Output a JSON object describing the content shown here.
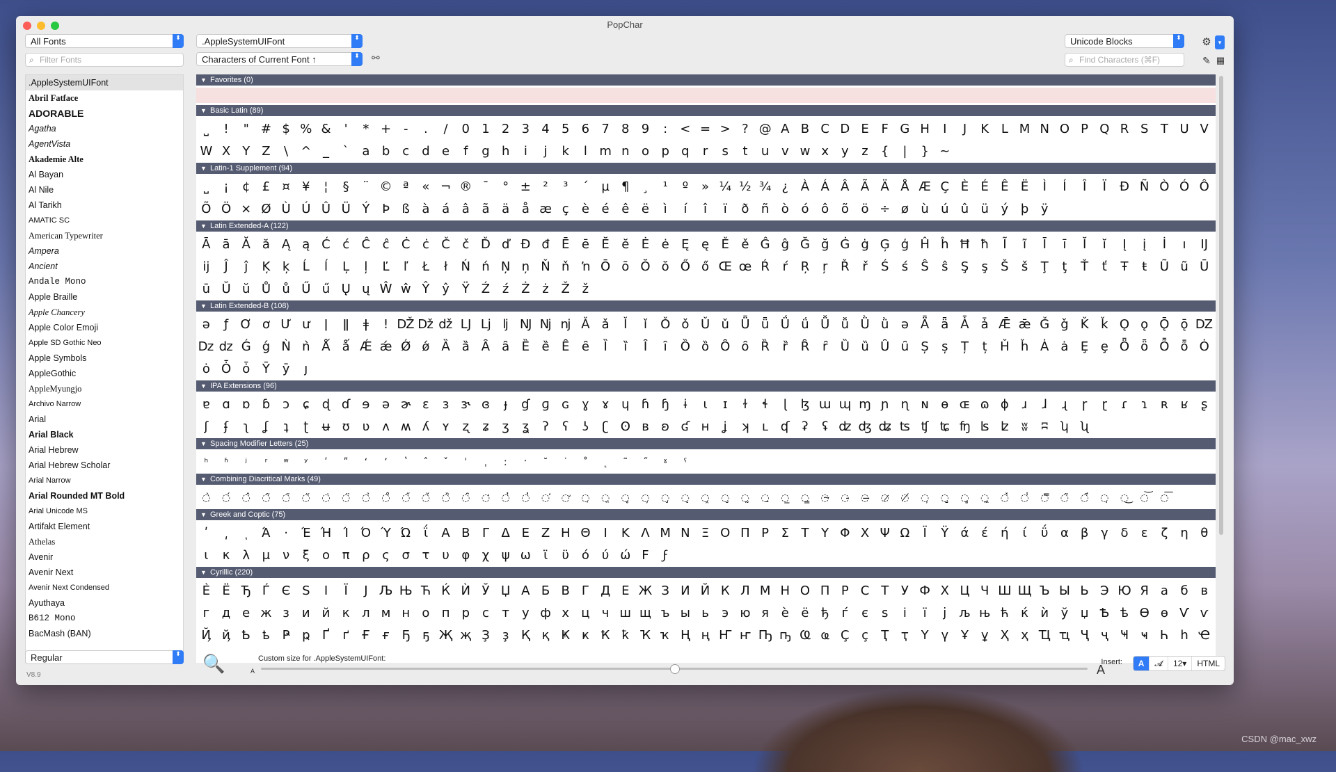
{
  "window": {
    "title": "PopChar"
  },
  "toolbar": {
    "font_filter_select": "All Fonts",
    "filter_fonts_placeholder": "Filter Fonts",
    "current_font_select": ".AppleSystemUIFont",
    "character_set_select": "Characters of Current Font ↑",
    "view_mode_select": "Unicode Blocks",
    "find_placeholder": "Find Characters (⌘F)"
  },
  "icons": {
    "search": "⌕",
    "link": "⚯",
    "gear": "⚙",
    "chevron": "▾",
    "pencil": "✎",
    "grid": "▦",
    "zoom": "🔍",
    "triangle": "▼",
    "updown": "⬍"
  },
  "font_list": [
    ".AppleSystemUIFont",
    "Abril Fatface",
    "ADORABLE",
    "Agatha",
    "AgentVista",
    "Akademie Alte",
    "Al Bayan",
    "Al Nile",
    "Al Tarikh",
    "AMATIC SC",
    "American Typewriter",
    "Ampera",
    "Ancient",
    "Andale Mono",
    "Apple Braille",
    "Apple Chancery",
    "Apple Color Emoji",
    "Apple SD Gothic Neo",
    "Apple Symbols",
    "AppleGothic",
    "AppleMyungjo",
    "Archivo Narrow",
    "Arial",
    "Arial Black",
    "Arial Hebrew",
    "Arial Hebrew Scholar",
    "Arial Narrow",
    "Arial Rounded MT Bold",
    "Arial Unicode MS",
    "Artifakt Element",
    "Athelas",
    "Avenir",
    "Avenir Next",
    "Avenir Next Condensed",
    "Ayuthaya",
    "B612 Mono",
    "BacMash (BAN)"
  ],
  "style_select": "Regular",
  "version": "V8.9",
  "blocks": [
    {
      "title": "Favorites (0)",
      "rows": []
    },
    {
      "title": "Basic Latin (89)",
      "rows": [
        [
          "⎵",
          "!",
          "\"",
          "#",
          "$",
          "%",
          "&",
          "'",
          "*",
          "+",
          "-",
          ".",
          "/",
          "0",
          "1",
          "2",
          "3",
          "4",
          "5",
          "6",
          "7",
          "8",
          "9",
          ":",
          "<",
          "=",
          ">",
          "?",
          "@",
          "A",
          "B",
          "C",
          "D",
          "E",
          "F",
          "G",
          "H",
          "I",
          "J",
          "K",
          "L",
          "M",
          "N",
          "O",
          "P",
          "Q",
          "R",
          "S",
          "T",
          "U",
          "V"
        ],
        [
          "W",
          "X",
          "Y",
          "Z",
          "\\",
          "^",
          "_",
          "`",
          "a",
          "b",
          "c",
          "d",
          "e",
          "f",
          "g",
          "h",
          "i",
          "j",
          "k",
          "l",
          "m",
          "n",
          "o",
          "p",
          "q",
          "r",
          "s",
          "t",
          "u",
          "v",
          "w",
          "x",
          "y",
          "z",
          "{",
          "|",
          "}",
          "~"
        ]
      ]
    },
    {
      "title": "Latin-1 Supplement (94)",
      "rows": [
        [
          "⎵",
          "¡",
          "¢",
          "£",
          "¤",
          "¥",
          "¦",
          "§",
          "¨",
          "©",
          "ª",
          "«",
          "¬",
          "®",
          "¯",
          "°",
          "±",
          "²",
          "³",
          "´",
          "µ",
          "¶",
          "¸",
          "¹",
          "º",
          "»",
          "¼",
          "½",
          "¾",
          "¿",
          "À",
          "Á",
          "Â",
          "Ã",
          "Ä",
          "Å",
          "Æ",
          "Ç",
          "È",
          "É",
          "Ê",
          "Ë",
          "Ì",
          "Í",
          "Î",
          "Ï",
          "Ð",
          "Ñ",
          "Ò",
          "Ó",
          "Ô"
        ],
        [
          "Õ",
          "Ö",
          "×",
          "Ø",
          "Ù",
          "Ú",
          "Û",
          "Ü",
          "Ý",
          "Þ",
          "ß",
          "à",
          "á",
          "â",
          "ã",
          "ä",
          "å",
          "æ",
          "ç",
          "è",
          "é",
          "ê",
          "ë",
          "ì",
          "í",
          "î",
          "ï",
          "ð",
          "ñ",
          "ò",
          "ó",
          "ô",
          "õ",
          "ö",
          "÷",
          "ø",
          "ù",
          "ú",
          "û",
          "ü",
          "ý",
          "þ",
          "ÿ"
        ]
      ]
    },
    {
      "title": "Latin Extended-A (122)",
      "rows": [
        [
          "Ā",
          "ā",
          "Ă",
          "ă",
          "Ą",
          "ą",
          "Ć",
          "ć",
          "Ĉ",
          "ĉ",
          "Ċ",
          "ċ",
          "Č",
          "č",
          "Ď",
          "ď",
          "Đ",
          "đ",
          "Ē",
          "ē",
          "Ĕ",
          "ĕ",
          "Ė",
          "ė",
          "Ę",
          "ę",
          "Ě",
          "ě",
          "Ĝ",
          "ĝ",
          "Ğ",
          "ğ",
          "Ġ",
          "ġ",
          "Ģ",
          "ģ",
          "Ĥ",
          "ĥ",
          "Ħ",
          "ħ",
          "Ĩ",
          "ĩ",
          "Ī",
          "ī",
          "Ĭ",
          "ĭ",
          "Į",
          "į",
          "İ",
          "ı",
          "Ĳ"
        ],
        [
          "ĳ",
          "Ĵ",
          "ĵ",
          "Ķ",
          "ķ",
          "Ĺ",
          "ĺ",
          "Ļ",
          "ļ",
          "Ľ",
          "ľ",
          "Ł",
          "ł",
          "Ń",
          "ń",
          "Ņ",
          "ņ",
          "Ň",
          "ň",
          "ŉ",
          "Ō",
          "ō",
          "Ŏ",
          "ŏ",
          "Ő",
          "ő",
          "Œ",
          "œ",
          "Ŕ",
          "ŕ",
          "Ŗ",
          "ŗ",
          "Ř",
          "ř",
          "Ś",
          "ś",
          "Ŝ",
          "ŝ",
          "Ş",
          "ş",
          "Š",
          "š",
          "Ţ",
          "ţ",
          "Ť",
          "ť",
          "Ŧ",
          "ŧ",
          "Ũ",
          "ũ",
          "Ū"
        ],
        [
          "ū",
          "Ŭ",
          "ŭ",
          "Ů",
          "ů",
          "Ű",
          "ű",
          "Ų",
          "ų",
          "Ŵ",
          "ŵ",
          "Ŷ",
          "ŷ",
          "Ÿ",
          "Ź",
          "ź",
          "Ż",
          "ż",
          "Ž",
          "ž"
        ]
      ]
    },
    {
      "title": "Latin Extended-B (108)",
      "rows": [
        [
          "ə",
          "ƒ",
          "Ơ",
          "ơ",
          "Ư",
          "ư",
          "ǀ",
          "ǁ",
          "ǂ",
          "ǃ",
          "Ǆ",
          "ǅ",
          "ǆ",
          "Ǉ",
          "ǈ",
          "ǉ",
          "Ǌ",
          "ǋ",
          "ǌ",
          "Ǎ",
          "ǎ",
          "Ǐ",
          "ǐ",
          "Ǒ",
          "ǒ",
          "Ǔ",
          "ǔ",
          "Ǖ",
          "ǖ",
          "Ǘ",
          "ǘ",
          "Ǚ",
          "ǚ",
          "Ǜ",
          "ǜ",
          "ǝ",
          "Ǟ",
          "ǟ",
          "Ǡ",
          "ǡ",
          "Ǣ",
          "ǣ",
          "Ǧ",
          "ǧ",
          "Ǩ",
          "ǩ",
          "Ǫ",
          "ǫ",
          "Ǭ",
          "ǭ",
          "Ǳ"
        ],
        [
          "ǲ",
          "ǳ",
          "Ǵ",
          "ǵ",
          "Ǹ",
          "ǹ",
          "Ǻ",
          "ǻ",
          "Ǽ",
          "ǽ",
          "Ǿ",
          "ǿ",
          "Ȁ",
          "ȁ",
          "Ȃ",
          "ȃ",
          "Ȅ",
          "ȅ",
          "Ȇ",
          "ȇ",
          "Ȉ",
          "ȉ",
          "Ȋ",
          "ȋ",
          "Ȍ",
          "ȍ",
          "Ȏ",
          "ȏ",
          "Ȑ",
          "ȑ",
          "Ȓ",
          "ȓ",
          "Ȕ",
          "ȕ",
          "Ȗ",
          "ȗ",
          "Ș",
          "ș",
          "Ț",
          "ț",
          "Ȟ",
          "ȟ",
          "Ȧ",
          "ȧ",
          "Ȩ",
          "ȩ",
          "Ȫ",
          "ȫ",
          "Ȭ",
          "ȭ",
          "Ȯ"
        ],
        [
          "ȯ",
          "Ȱ",
          "ȱ",
          "Ȳ",
          "ȳ",
          "ȷ"
        ]
      ]
    },
    {
      "title": "IPA Extensions (96)",
      "rows": [
        [
          "ɐ",
          "ɑ",
          "ɒ",
          "ɓ",
          "ɔ",
          "ɕ",
          "ɖ",
          "ɗ",
          "ɘ",
          "ə",
          "ɚ",
          "ɛ",
          "ɜ",
          "ɝ",
          "ɞ",
          "ɟ",
          "ɠ",
          "ɡ",
          "ɢ",
          "ɣ",
          "ɤ",
          "ɥ",
          "ɦ",
          "ɧ",
          "ɨ",
          "ɩ",
          "ɪ",
          "ɫ",
          "ɬ",
          "ɭ",
          "ɮ",
          "ɯ",
          "ɰ",
          "ɱ",
          "ɲ",
          "ɳ",
          "ɴ",
          "ɵ",
          "ɶ",
          "ɷ",
          "ɸ",
          "ɹ",
          "ɺ",
          "ɻ",
          "ɼ",
          "ɽ",
          "ɾ",
          "ɿ",
          "ʀ",
          "ʁ",
          "ʂ"
        ],
        [
          "ʃ",
          "ʄ",
          "ʅ",
          "ʆ",
          "ʇ",
          "ʈ",
          "ʉ",
          "ʊ",
          "ʋ",
          "ʌ",
          "ʍ",
          "ʎ",
          "ʏ",
          "ʐ",
          "ʑ",
          "ʒ",
          "ʓ",
          "ʔ",
          "ʕ",
          "ʖ",
          "ʗ",
          "ʘ",
          "ʙ",
          "ʚ",
          "ʛ",
          "ʜ",
          "ʝ",
          "ʞ",
          "ʟ",
          "ʠ",
          "ʡ",
          "ʢ",
          "ʣ",
          "ʤ",
          "ʥ",
          "ʦ",
          "ʧ",
          "ʨ",
          "ʩ",
          "ʪ",
          "ʫ",
          "ʬ",
          "ʭ",
          "ʮ",
          "ʯ"
        ]
      ]
    },
    {
      "title": "Spacing Modifier Letters (25)",
      "rows": [
        [
          "ʰ",
          "ʱ",
          "ʲ",
          "ʳ",
          "ʷ",
          "ʸ",
          "ʹ",
          "ʺ",
          "ʻ",
          "ʼ",
          "ʽ",
          "ˆ",
          "ˇ",
          "ˈ",
          "ˌ",
          "ː",
          "ˑ",
          "˘",
          "˙",
          "˚",
          "˛",
          "˜",
          "˝",
          "ˠ",
          "ˤ"
        ]
      ]
    },
    {
      "title": "Combining Diacritical Marks (49)",
      "rows": [
        [
          "◌̀",
          "◌́",
          "◌̂",
          "◌̃",
          "◌̄",
          "◌̆",
          "◌̇",
          "◌̈",
          "◌̉",
          "◌̊",
          "◌̋",
          "◌̌",
          "◌̏",
          "◌̑",
          "◌̒",
          "◌̓",
          "◌̔",
          "◌̕",
          "◌̛",
          "◌̣",
          "◌̤",
          "◌̥",
          "◌̦",
          "◌̧",
          "◌̨",
          "◌̭",
          "◌̮",
          "◌̰",
          "◌̱",
          "◌̲",
          "◌̳",
          "◌̴",
          "◌̵",
          "◌̶",
          "◌̷",
          "◌̸",
          "◌̹",
          "◌̺",
          "◌̻",
          "◌̼",
          "◌̽",
          "◌̾",
          "◌̿",
          "◌͂",
          "◌̈́",
          "◌ͅ",
          "◌͜",
          "◌͝",
          "◌͞"
        ]
      ]
    },
    {
      "title": "Greek and Coptic (75)",
      "rows": [
        [
          "ʹ",
          "͵",
          "ͺ",
          "Ά",
          "·",
          "Έ",
          "Ή",
          "Ί",
          "Ό",
          "Ύ",
          "Ώ",
          "ΐ",
          "Α",
          "Β",
          "Γ",
          "Δ",
          "Ε",
          "Ζ",
          "Η",
          "Θ",
          "Ι",
          "Κ",
          "Λ",
          "Μ",
          "Ν",
          "Ξ",
          "Ο",
          "Π",
          "Ρ",
          "Σ",
          "Τ",
          "Υ",
          "Φ",
          "Χ",
          "Ψ",
          "Ω",
          "Ϊ",
          "Ϋ",
          "ά",
          "έ",
          "ή",
          "ί",
          "ΰ",
          "α",
          "β",
          "γ",
          "δ",
          "ε",
          "ζ",
          "η",
          "θ"
        ],
        [
          "ι",
          "κ",
          "λ",
          "μ",
          "ν",
          "ξ",
          "ο",
          "π",
          "ρ",
          "ς",
          "σ",
          "τ",
          "υ",
          "φ",
          "χ",
          "ψ",
          "ω",
          "ϊ",
          "ϋ",
          "ό",
          "ύ",
          "ώ",
          "Ϝ",
          "ϝ"
        ]
      ]
    },
    {
      "title": "Cyrillic (220)",
      "rows": [
        [
          "Ѐ",
          "Ё",
          "Ђ",
          "Ѓ",
          "Є",
          "Ѕ",
          "І",
          "Ї",
          "Ј",
          "Љ",
          "Њ",
          "Ћ",
          "Ќ",
          "Ѝ",
          "Ў",
          "Џ",
          "А",
          "Б",
          "В",
          "Г",
          "Д",
          "Е",
          "Ж",
          "З",
          "И",
          "Й",
          "К",
          "Л",
          "М",
          "Н",
          "О",
          "П",
          "Р",
          "С",
          "Т",
          "У",
          "Ф",
          "Х",
          "Ц",
          "Ч",
          "Ш",
          "Щ",
          "Ъ",
          "Ы",
          "Ь",
          "Э",
          "Ю",
          "Я",
          "а",
          "б",
          "в"
        ],
        [
          "г",
          "д",
          "е",
          "ж",
          "з",
          "и",
          "й",
          "к",
          "л",
          "м",
          "н",
          "о",
          "п",
          "р",
          "с",
          "т",
          "у",
          "ф",
          "х",
          "ц",
          "ч",
          "ш",
          "щ",
          "ъ",
          "ы",
          "ь",
          "э",
          "ю",
          "я",
          "ѐ",
          "ё",
          "ђ",
          "ѓ",
          "є",
          "ѕ",
          "і",
          "ї",
          "ј",
          "љ",
          "њ",
          "ћ",
          "ќ",
          "ѝ",
          "ў",
          "џ",
          "Ѣ",
          "ѣ",
          "Ѳ",
          "ѳ",
          "Ѵ",
          "ѵ"
        ],
        [
          "Ҋ",
          "ҋ",
          "Ҍ",
          "ҍ",
          "Ҏ",
          "ҏ",
          "Ґ",
          "ґ",
          "Ғ",
          "ғ",
          "Ҕ",
          "ҕ",
          "Җ",
          "җ",
          "Ҙ",
          "ҙ",
          "Қ",
          "қ",
          "Ҝ",
          "ҝ",
          "Ҟ",
          "ҟ",
          "Ҡ",
          "ҡ",
          "Ң",
          "ң",
          "Ҥ",
          "ҥ",
          "Ҧ",
          "ҧ",
          "Ҩ",
          "ҩ",
          "Ҫ",
          "ҫ",
          "Ҭ",
          "ҭ",
          "Ү",
          "ү",
          "Ұ",
          "ұ",
          "Ҳ",
          "ҳ",
          "Ҵ",
          "ҵ",
          "Ҷ",
          "ҷ",
          "Ҹ",
          "ҹ",
          "Һ",
          "һ",
          "Ҽ"
        ]
      ]
    }
  ],
  "bottom": {
    "custom_size_label": "Custom size for .AppleSystemUIFont:",
    "a_small": "A",
    "a_big": "A",
    "insert_label": "Insert:",
    "insert_modes": [
      "A",
      "𝓐",
      "12▾",
      "HTML"
    ],
    "active_mode_index": 0,
    "size_fraction": 0.5
  },
  "watermark": "CSDN @mac_xwz"
}
